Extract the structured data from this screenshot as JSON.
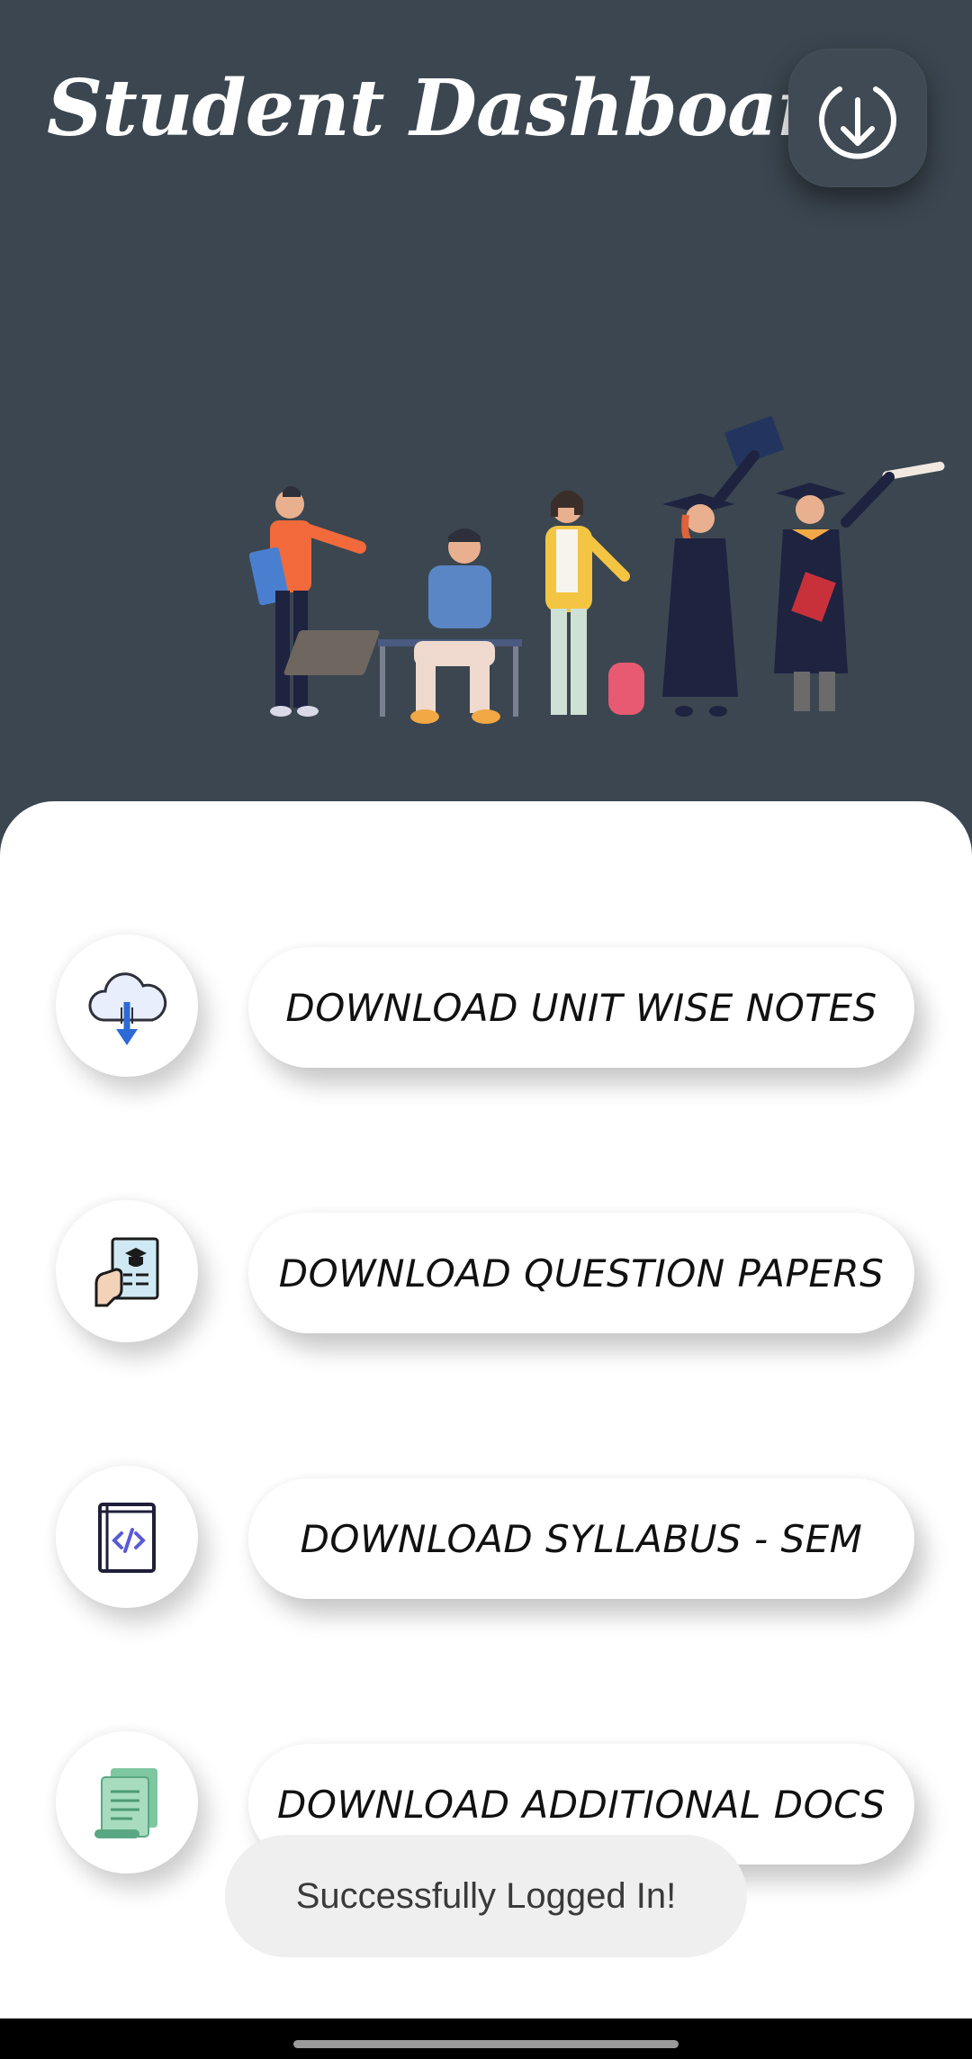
{
  "app": {
    "title": "Student Dashboard"
  },
  "header": {
    "download_icon": "download-circle-icon"
  },
  "menu": [
    {
      "label": "DOWNLOAD UNIT WISE NOTES",
      "icon": "cloud-download-icon"
    },
    {
      "label": "DOWNLOAD QUESTION PAPERS",
      "icon": "question-paper-icon"
    },
    {
      "label": "DOWNLOAD SYLLABUS - SEM",
      "icon": "code-book-icon"
    },
    {
      "label": "DOWNLOAD ADDITIONAL DOCS",
      "icon": "documents-scroll-icon"
    }
  ],
  "toast": {
    "message": "Successfully Logged In!"
  },
  "colors": {
    "header_bg": "#3b4650",
    "sheet_bg": "#ffffff",
    "toast_bg": "#efefef"
  }
}
